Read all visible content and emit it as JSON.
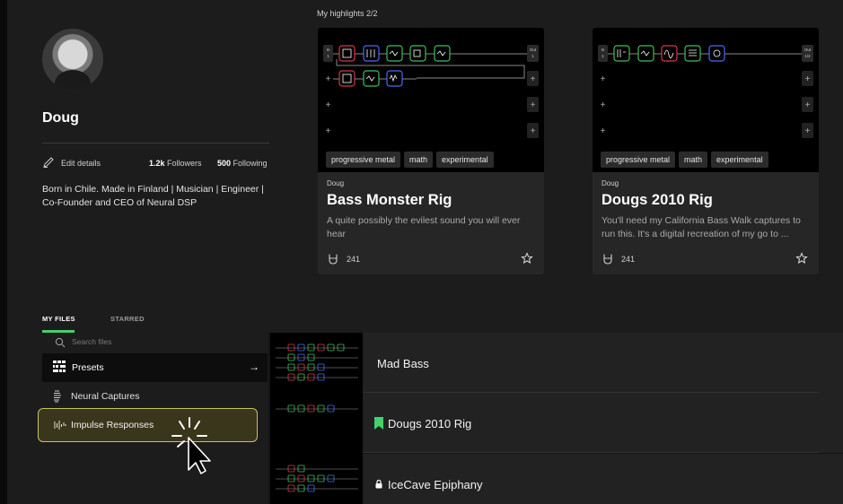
{
  "profile": {
    "name": "Doug",
    "edit_label": "Edit details",
    "followers_count": "1.2k",
    "followers_label": "Followers",
    "following_count": "500",
    "following_label": "Following",
    "bio": "Born in Chile. Made in Finland | Musician | Engineer | Co-Founder and CEO of Neural DSP"
  },
  "highlights": {
    "title": "My highlights 2/2",
    "cards": [
      {
        "author": "Doug",
        "title": "Bass Monster Rig",
        "description": "A quite possibly the evilest sound you will ever hear",
        "likes": "241",
        "tags": [
          "progressive metal",
          "math",
          "experimental"
        ],
        "io": {
          "in_top": "In",
          "in_bottom": "1",
          "out_top": "Out",
          "out_bottom": "1"
        }
      },
      {
        "author": "Doug",
        "title": "Dougs 2010 Rig",
        "description": "You'll need my California Bass Walk captures to run this. It's a digital recreation of my go to ...",
        "likes": "241",
        "tags": [
          "progressive metal",
          "math",
          "experimental"
        ],
        "io": {
          "in_top": "In",
          "in_bottom": "1",
          "out_top": "Out",
          "out_bottom": "1/2"
        }
      }
    ]
  },
  "tabs": {
    "my_files": "MY FILES",
    "starred": "STARRED"
  },
  "sidebar": {
    "search_placeholder": "Search files",
    "presets": "Presets",
    "presets_arrow": "→",
    "neural_captures": "Neural Captures",
    "impulse_responses": "Impulse Responses"
  },
  "files": [
    {
      "name": "Mad Bass",
      "icon": "none"
    },
    {
      "name": "Dougs 2010 Rig",
      "icon": "bookmark-icon"
    },
    {
      "name": "IceCave Epiphany",
      "icon": "lock-icon"
    }
  ],
  "colors": {
    "accent_green": "#44d06b",
    "selected_border": "#c9c25a",
    "block_red": "#d23a4a",
    "block_blue": "#4a6cf0",
    "block_green": "#3fbf5a"
  }
}
